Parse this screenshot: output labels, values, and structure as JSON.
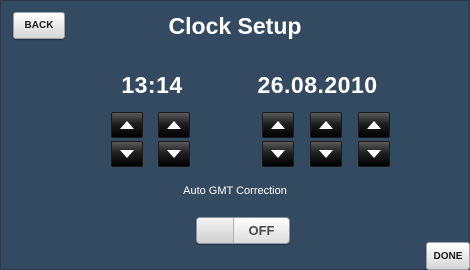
{
  "header": {
    "back_label": "BACK",
    "title": "Clock Setup"
  },
  "time": {
    "value": "13:14"
  },
  "date": {
    "value": "26.08.2010"
  },
  "gmt": {
    "label": "Auto GMT Correction",
    "toggle_state": "OFF"
  },
  "footer": {
    "done_label": "DONE"
  },
  "colors": {
    "background": "#344a60",
    "button_dark": "#000000",
    "button_light": "#ffffff"
  },
  "icons": {
    "up": "triangle-up-icon",
    "down": "triangle-down-icon"
  }
}
